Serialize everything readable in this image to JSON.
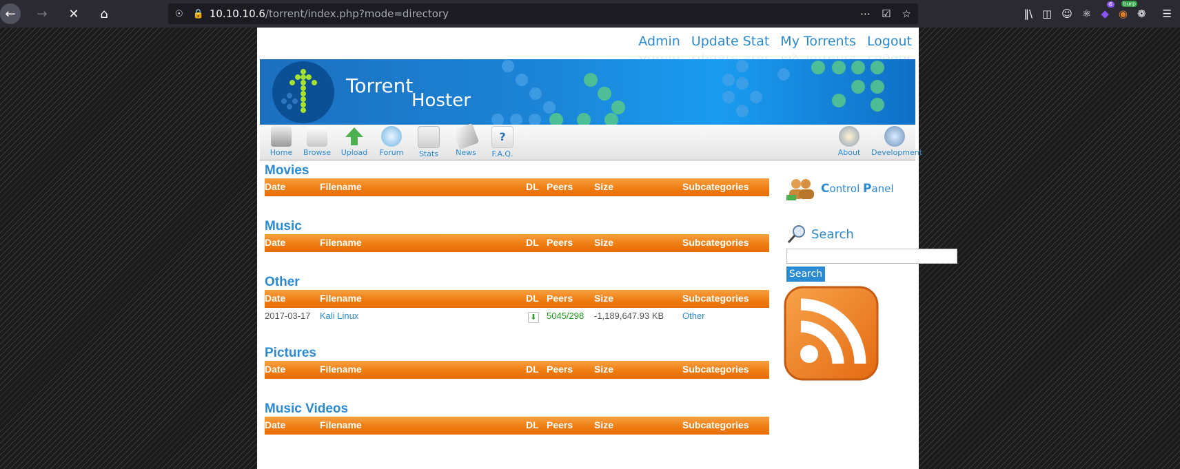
{
  "browser": {
    "url_host": "10.10.10.6",
    "url_path": "/torrent/index.php?mode=directory",
    "ext_badge": "6",
    "burp_label": "burp"
  },
  "page": {
    "topnav": [
      "Admin",
      "Update Stat",
      "My Torrents",
      "Logout"
    ],
    "banner": {
      "title1": "Torrent",
      "title2": "Hoster"
    },
    "iconbar_left": [
      {
        "label": "Home",
        "icon": "home-icon",
        "color": "#7a7a7a"
      },
      {
        "label": "Browse",
        "icon": "browse-icon",
        "color": "#c9c9c9"
      },
      {
        "label": "Upload",
        "icon": "upload-icon",
        "color": "#4caf50"
      },
      {
        "label": "Forum",
        "icon": "forum-icon",
        "color": "#6fb3e0"
      },
      {
        "label": "Stats",
        "icon": "stats-icon",
        "color": "#d9534f"
      },
      {
        "label": "News",
        "icon": "news-icon",
        "color": "#b0b0b0"
      },
      {
        "label": "F.A.Q.",
        "icon": "faq-icon",
        "color": "#2a6fb8"
      }
    ],
    "iconbar_right": [
      {
        "label": "About",
        "icon": "about-icon",
        "color": "#e8a040"
      },
      {
        "label": "Development",
        "icon": "development-icon",
        "color": "#6a9fd0"
      }
    ],
    "table_headers": {
      "date": "Date",
      "filename": "Filename",
      "dl": "DL",
      "peers": "Peers",
      "size": "Size",
      "subcategories": "Subcategories"
    },
    "sections": [
      {
        "title": "Movies",
        "rows": []
      },
      {
        "title": "Music",
        "rows": []
      },
      {
        "title": "Other",
        "rows": [
          {
            "date": "2017-03-17",
            "filename": "Kali Linux",
            "peers": "5045/298",
            "size": "-1,189,647.93 KB",
            "subcategory": "Other"
          }
        ]
      },
      {
        "title": "Pictures",
        "rows": []
      },
      {
        "title": "Music Videos",
        "rows": []
      }
    ],
    "sidebar": {
      "control_panel_c": "C",
      "control_panel_rest1": "ontrol ",
      "control_panel_p": "P",
      "control_panel_rest2": "anel",
      "search_title": "Search",
      "search_value": "",
      "search_button": "Search"
    }
  }
}
